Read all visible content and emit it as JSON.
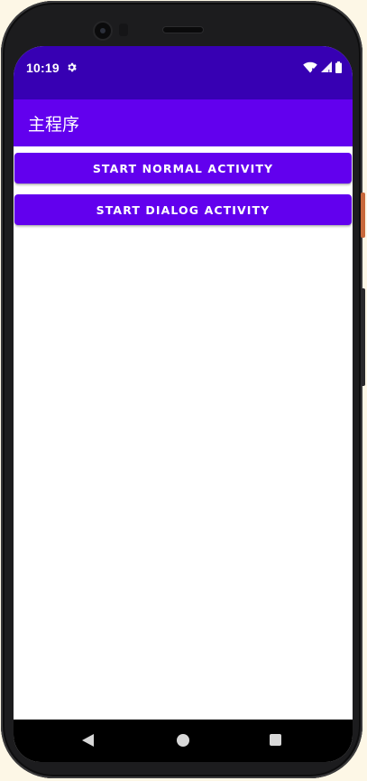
{
  "status_bar": {
    "time": "10:19",
    "icons": [
      "gear-icon",
      "wifi-icon",
      "signal-icon",
      "battery-icon"
    ]
  },
  "app_bar": {
    "title": "主程序"
  },
  "main": {
    "buttons": [
      {
        "label": "START NORMAL ACTIVITY"
      },
      {
        "label": "START DIALOG ACTIVITY"
      }
    ]
  },
  "nav_bar": {
    "icons": [
      "back-icon",
      "home-icon",
      "recents-icon"
    ]
  },
  "colors": {
    "status_bar": "#3700b3",
    "primary": "#6200ee",
    "on_primary": "#ffffff",
    "background": "#ffffff",
    "nav_bar": "#000000"
  }
}
